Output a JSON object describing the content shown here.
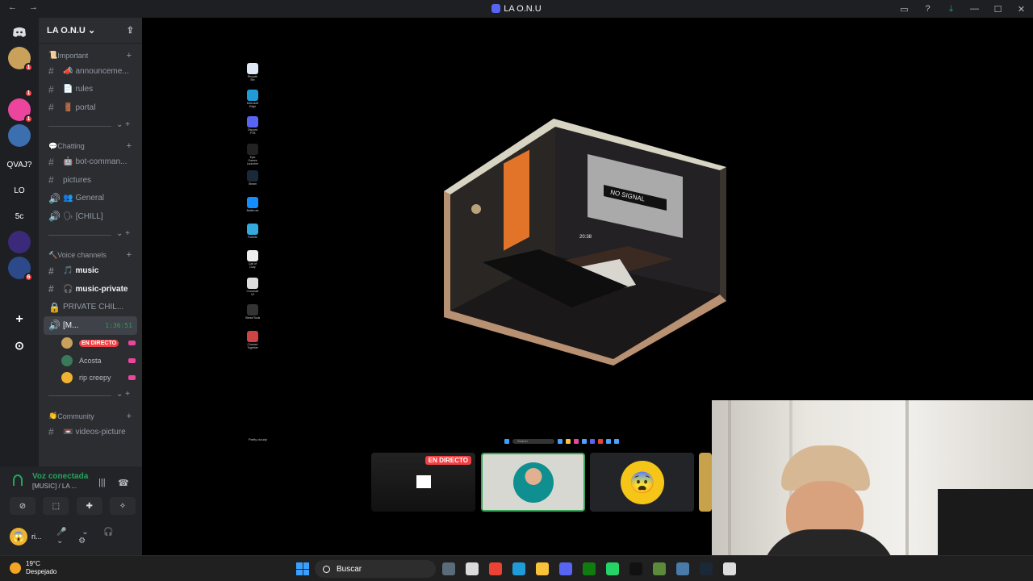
{
  "window": {
    "title": "LA O.N.U",
    "nav": "← →"
  },
  "titlebar_icons": [
    "monitor-icon",
    "help-icon",
    "download-icon",
    "minimize-icon",
    "maximize-icon",
    "close-icon"
  ],
  "titlebar_glyphs": {
    "monitor": "▭",
    "help": "?",
    "download": "⤓",
    "minimize": "—",
    "maximize": "☐",
    "close": "✕"
  },
  "guilds": {
    "home_icon": "discord-icon",
    "items": [
      {
        "label": "",
        "badge": "1",
        "color": "#c9a15a"
      },
      {
        "label": "",
        "badge": "1",
        "color": "#1e1f22"
      },
      {
        "label": "",
        "badge": "1",
        "color": "#eb459e"
      },
      {
        "label": "",
        "badge": "",
        "color": "#3b6fb0"
      },
      {
        "label": "QVAJ?",
        "badge": "",
        "color": "transparent"
      },
      {
        "label": "LO",
        "badge": "",
        "color": "transparent"
      },
      {
        "label": "5c",
        "badge": "",
        "color": "transparent"
      },
      {
        "label": "",
        "badge": "",
        "color": "#3b2a7a"
      },
      {
        "label": "",
        "badge": "6",
        "color": "#2c4a8a"
      },
      {
        "label": "",
        "badge": "",
        "color": "#1e1f22"
      }
    ],
    "add_glyph": "+",
    "explore_glyph": "⊙"
  },
  "server": {
    "name": "LA O.N.U",
    "chevron": "⌄",
    "invite_glyph": "⇪"
  },
  "categories": [
    {
      "name": "Important",
      "emoji": "📜",
      "channels": [
        {
          "type": "text",
          "name": "announceme...",
          "emoji": "📣"
        },
        {
          "type": "text",
          "name": "rules",
          "emoji": "📄"
        },
        {
          "type": "text",
          "name": "portal",
          "emoji": "🚪"
        }
      ]
    },
    {
      "name": "Chatting",
      "emoji": "💬",
      "channels": [
        {
          "type": "text",
          "name": "bot-comman...",
          "emoji": "🤖"
        },
        {
          "type": "text",
          "name": "pictures",
          "emoji": ""
        },
        {
          "type": "voice",
          "name": "General",
          "emoji": "👥"
        },
        {
          "type": "voice",
          "name": "[CHILL]",
          "emoji": "🗣"
        }
      ]
    },
    {
      "name": "Voice channels",
      "emoji": "🔨",
      "channels": [
        {
          "type": "text",
          "name": "music",
          "emoji": "🎵",
          "bold": true
        },
        {
          "type": "text",
          "name": "music-private",
          "emoji": "🎧",
          "bold": true
        },
        {
          "type": "voice",
          "name": "PRIVATE CHIL...",
          "emoji": "",
          "locked": true
        },
        {
          "type": "voice",
          "name": "[M...",
          "emoji": "",
          "active": true,
          "time": "1:36:51"
        }
      ]
    }
  ],
  "voice_users": [
    {
      "name": "",
      "live": "EN DIRECTO",
      "color": "#c9a15a"
    },
    {
      "name": "Acosta",
      "live": "",
      "color": "#3a7a5a"
    },
    {
      "name": "rip creepy",
      "live": "",
      "color": "#f0b232"
    }
  ],
  "community": {
    "name": "Community",
    "emoji": "👏",
    "channels": [
      {
        "type": "text",
        "name": "videos-picture",
        "emoji": "📼"
      }
    ]
  },
  "voice_panel": {
    "status": "Voz conectada",
    "channel": "[MUSIC] / LA ...",
    "buttons": [
      "camera-off-icon",
      "screen-share-icon",
      "activities-icon",
      "soundboard-icon"
    ],
    "button_glyphs": [
      "⊘",
      "⬚",
      "✚",
      "✧"
    ],
    "waveform_glyph": "|||",
    "disconnect_glyph": "☎"
  },
  "user_panel": {
    "name": "ri...",
    "avatar_glyph": "😱",
    "controls": "🎤 ⌄ 🎧 ⌄ ⚙"
  },
  "stream_desktop": {
    "icons": [
      {
        "label": "Recycle Bin",
        "color": "#dfe9f5"
      },
      {
        "label": "Microsoft Edge",
        "color": "#1f9cd8"
      },
      {
        "label": "Discord PTB",
        "color": "#5865f2"
      },
      {
        "label": "Epic Games Launcher",
        "color": "#222"
      },
      {
        "label": "Steam",
        "color": "#1b2838"
      },
      {
        "label": "Battle.net",
        "color": "#148eff"
      },
      {
        "label": "Fortnite",
        "color": "#3ad"
      },
      {
        "label": "Call of Duty",
        "color": "#eee"
      },
      {
        "label": "Crosshair V2",
        "color": "#ddd"
      },
      {
        "label": "SteamTools",
        "color": "#333"
      },
      {
        "label": "Chained Together",
        "color": "#c44"
      }
    ],
    "room": {
      "tv_text": "NO SIGNAL",
      "clock": "20:38"
    },
    "weather_text": "Partly cloudy",
    "search_text": "Search"
  },
  "stream_tiles": [
    {
      "label": "EN DIRECTO",
      "kind": "stream"
    },
    {
      "label": "",
      "kind": "avatar-selected"
    },
    {
      "label": "",
      "kind": "emoji"
    },
    {
      "label": "",
      "kind": "partial"
    }
  ],
  "taskbar": {
    "temp": "19°C",
    "weather": "Despejado",
    "search": "Buscar",
    "apps": [
      "#5a6b7a",
      "#dbdbdb",
      "#ea4335",
      "#1f9cd8",
      "#f8c23a",
      "#5865f2",
      "#107c10",
      "#25d366",
      "#111",
      "#5a8a3a",
      "#4a7aa8",
      "#1b2838",
      "#ddd"
    ]
  }
}
